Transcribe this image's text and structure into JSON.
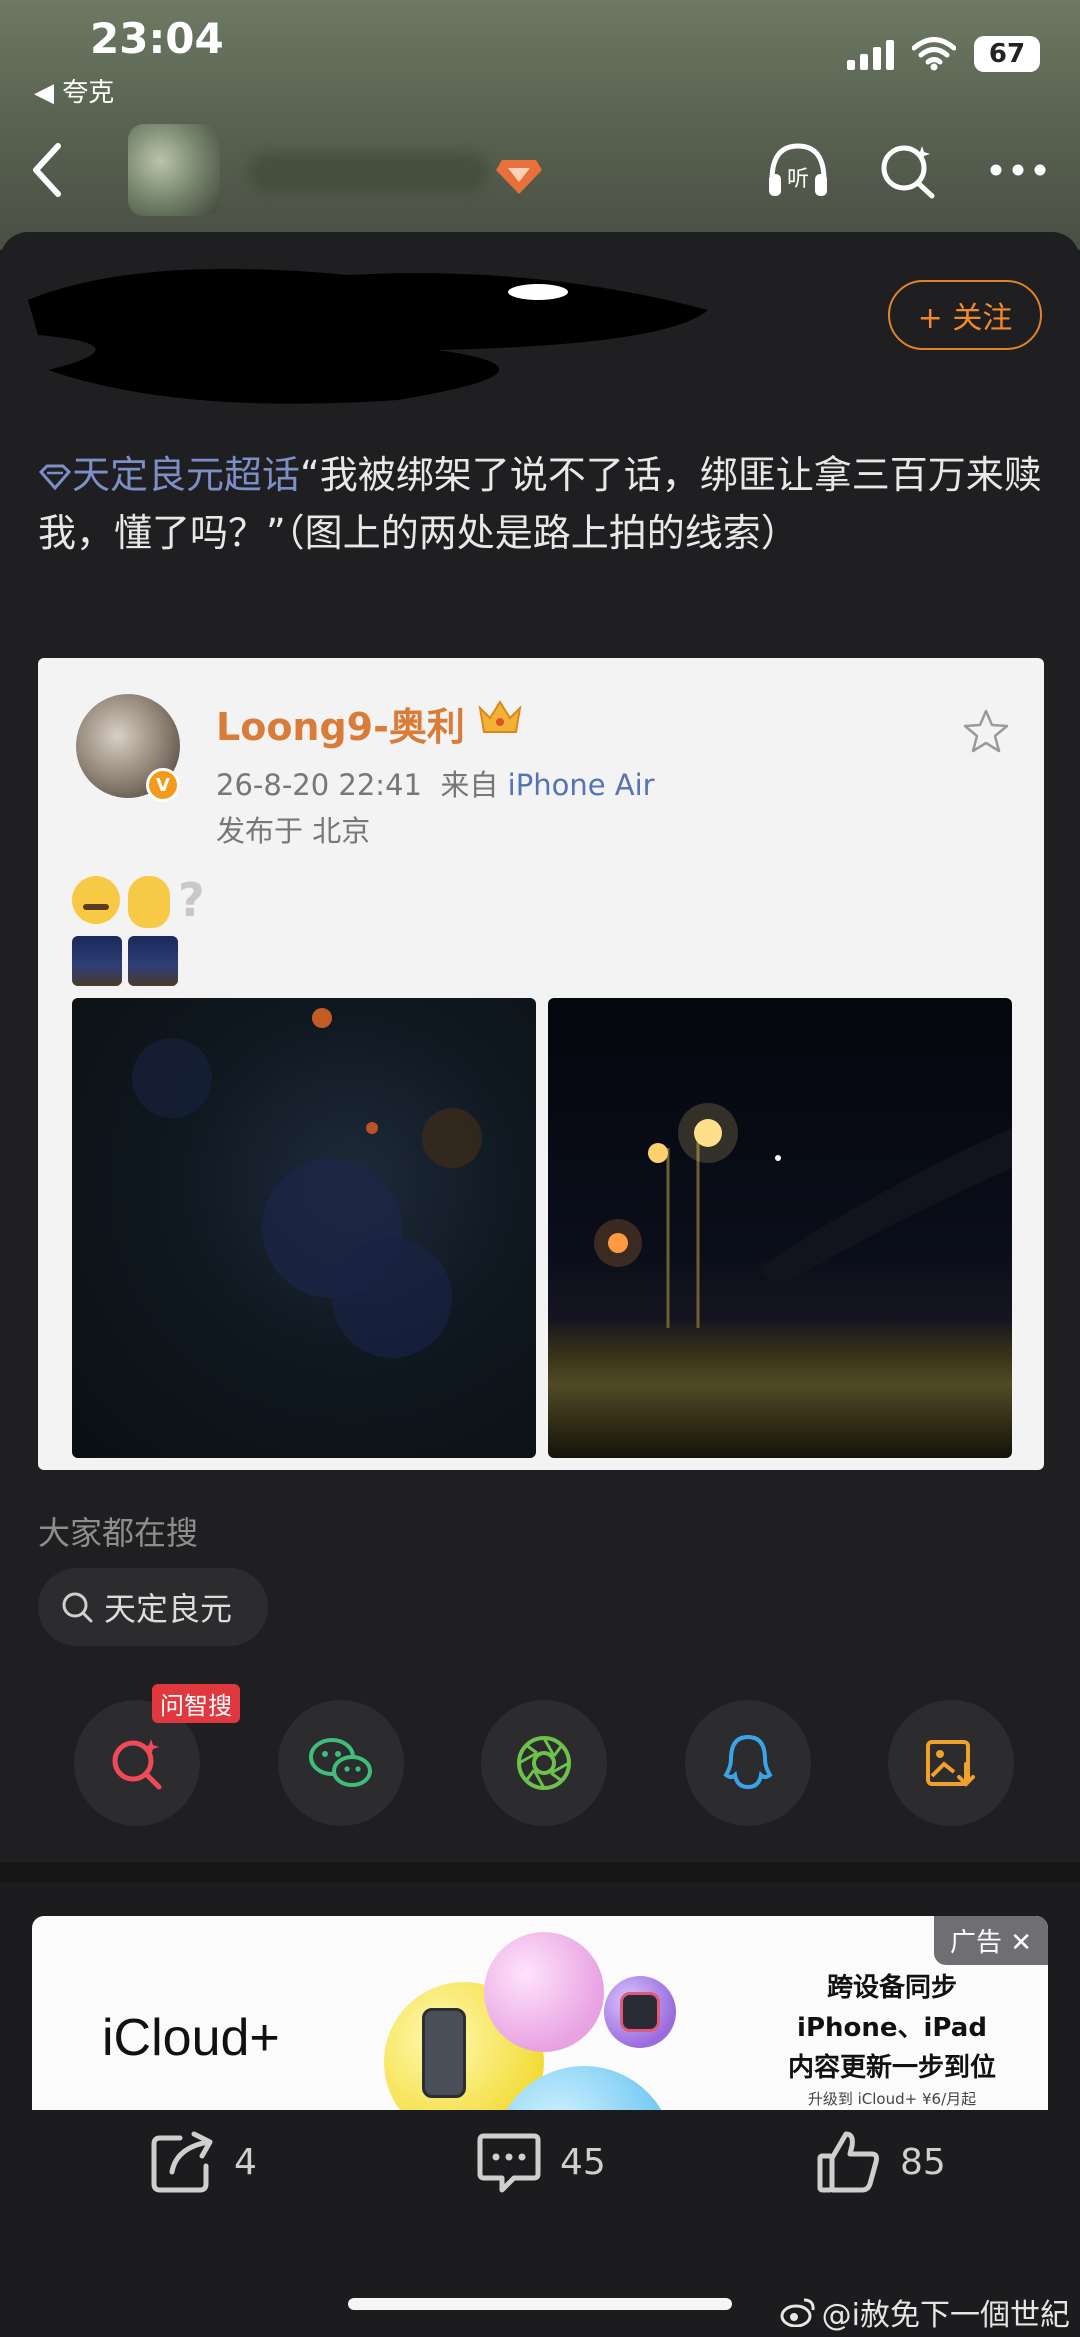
{
  "status": {
    "time": "23:04",
    "back_app": "◀ 夸克",
    "battery": "67"
  },
  "post": {
    "follow_label": "+ 关注",
    "topic": "天定良元超话",
    "text": "“我被绑架了说不了话，绑匪让拿三百万来赎我，懂了吗？”（图上的两处是路上拍的线索）"
  },
  "embedded": {
    "name": "Loong9-奥利",
    "date": "26-8-20 22:41",
    "source_prefix": "来自",
    "device": "iPhone Air",
    "location": "发布于 北京",
    "question_mark": "?"
  },
  "trending": {
    "title": "大家都在搜",
    "query": "天定良元"
  },
  "share": {
    "ask_badge": "问智搜"
  },
  "ad": {
    "brand": "iCloud+",
    "tag": "广告 ✕",
    "line1": "跨设备同步",
    "line2": "iPhone、iPad",
    "line3": "内容更新一步到位",
    "small": "升级到 iCloud+ ¥6/月起"
  },
  "actions": {
    "reposts": "4",
    "comments": "45",
    "likes": "85"
  },
  "watermark": "@i赦免下一個世紀",
  "colors": {
    "accent_orange": "#f08a2c",
    "topic_blue": "#7c8fc7",
    "device_blue": "#5474b4",
    "name_orange": "#d97c3a"
  }
}
